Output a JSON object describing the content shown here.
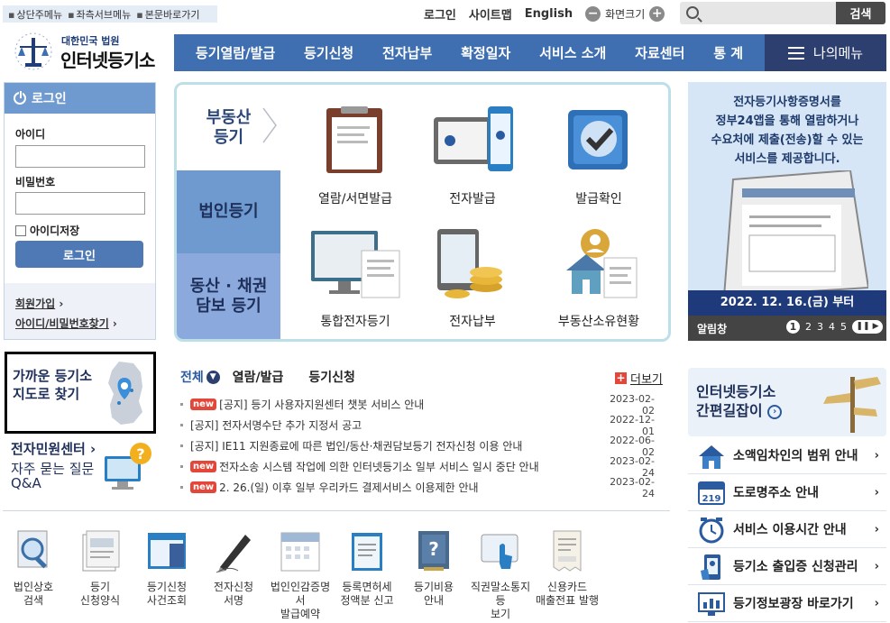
{
  "skip_links": [
    "상단주메뉴",
    "좌측서브메뉴",
    "본문바로가기"
  ],
  "util": {
    "login": "로그인",
    "sitemap": "사이트맵",
    "english": "English",
    "zoom_minus": "−",
    "zoom_label": "화면크기",
    "zoom_plus": "+"
  },
  "search": {
    "placeholder": "",
    "button": "검색"
  },
  "logo": {
    "sub": "대한민국 법원",
    "main": "인터넷등기소"
  },
  "nav": {
    "items": [
      "등기열람/발급",
      "등기신청",
      "전자납부",
      "확정일자",
      "서비스 소개",
      "자료센터",
      "통 계"
    ],
    "mymenu": "나의메뉴"
  },
  "login": {
    "title": "로그인",
    "id_label": "아이디",
    "pw_label": "비밀번호",
    "save_id": "아이디저장",
    "button": "로그인",
    "join": "회원가입",
    "find": "아이디/비밀번호찾기"
  },
  "center": {
    "tabs": [
      "부동산\n등기",
      "법인등기",
      "동산 · 채권\n담보 등기"
    ],
    "tiles": [
      "열람/서면발급",
      "전자발급",
      "발급확인",
      "통합전자등기",
      "전자납부",
      "부동산소유현황"
    ]
  },
  "banner": {
    "text": [
      "전자등기사항증명서를",
      "정부24앱을 통해 열람하거나",
      "수요처에 제출(전송)할 수 있는",
      "서비스를 제공합니다."
    ],
    "date": "2022. 12. 16.(금) 부터",
    "bar": "알림창",
    "pages": [
      "1",
      "2",
      "3",
      "4",
      "5"
    ],
    "ctrl": "❚❚ ▶"
  },
  "map": {
    "line1": "가까운 등기소",
    "line2": "지도로 찾기"
  },
  "cs": {
    "title": "전자민원센터",
    "faq1": "자주 묻는 질문",
    "faq2": "Q&A"
  },
  "notice_tabs": {
    "all": "전체",
    "t1": "열람/발급",
    "t2": "등기신청",
    "more": "더보기"
  },
  "notices": [
    {
      "new": true,
      "title": "[공지] 등기 사용자지원센터 챗봇 서비스 안내",
      "date": "2023-02-02"
    },
    {
      "new": false,
      "title": "[공지] 전자서명수단 추가 지정서 공고",
      "date": "2022-12-01"
    },
    {
      "new": false,
      "title": "[공지] IE11 지원종료에 따른 법인/동산·채권담보등기 전자신청 이용 안내",
      "date": "2022-06-02"
    },
    {
      "new": true,
      "title": "전자소송 시스템 작업에 의한 인터넷등기소 일부 서비스 일시 중단 안내",
      "date": "2023-02-24"
    },
    {
      "new": true,
      "title": "2. 26.(일) 이후 일부 우리카드 결제서비스 이용제한 안내",
      "date": "2023-02-24"
    }
  ],
  "new_badge": "new",
  "quick": [
    [
      "법인상호",
      "검색"
    ],
    [
      "등기",
      "신청양식"
    ],
    [
      "등기신청",
      "사건조회"
    ],
    [
      "전자신청",
      "서명"
    ],
    [
      "법인인감증명서",
      "발급예약"
    ],
    [
      "등록면허세",
      "정액분 신고"
    ],
    [
      "등기비용",
      "안내"
    ],
    [
      "직권말소통지등",
      "보기"
    ],
    [
      "신용카드",
      "매출전표 발행"
    ]
  ],
  "guide": {
    "line1": "인터넷등기소",
    "line2": "간편길잡이"
  },
  "rlist": [
    "소액임차인의 범위 안내",
    "도로명주소 안내",
    "서비스 이용시간 안내",
    "등기소 출입증 신청관리",
    "등기정보광장 바로가기"
  ],
  "colors": {
    "nav": "#3f6fb0",
    "mymenu": "#2d3f6f",
    "login_head": "#6f9ad0",
    "new_badge": "#e2473a"
  }
}
